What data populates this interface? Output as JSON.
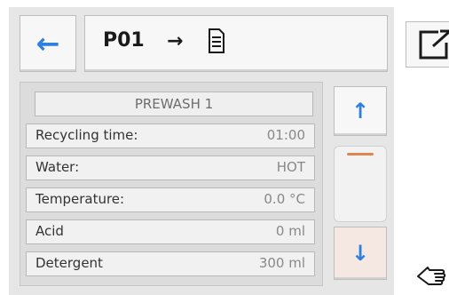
{
  "header": {
    "back_icon": "arrow-left-icon",
    "program_id": "P01",
    "arrow_glyph": "→",
    "doc_icon": "document-icon",
    "export_icon": "export-icon"
  },
  "section": {
    "title": "PREWASH 1"
  },
  "rows": [
    {
      "label": "Recycling time:",
      "value": "01:00"
    },
    {
      "label": "Water:",
      "value": "HOT"
    },
    {
      "label": "Temperature:",
      "value": "0.0 °C"
    },
    {
      "label": "Acid",
      "value": "0 ml"
    },
    {
      "label": "Detergent",
      "value": "300 ml"
    }
  ],
  "scroll": {
    "up_icon": "arrow-up-icon",
    "down_icon": "arrow-down-icon"
  },
  "colors": {
    "accent_blue": "#2f7fdc",
    "accent_orange": "#e08452",
    "panel_bg": "#e6e6e6"
  }
}
